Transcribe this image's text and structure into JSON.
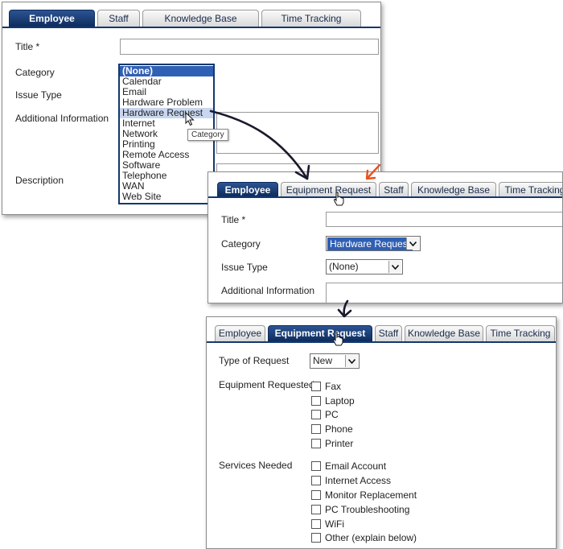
{
  "panel1": {
    "tabs": [
      "Employee",
      "Staff",
      "Knowledge Base",
      "Time Tracking"
    ],
    "labels": {
      "title": "Title *",
      "category": "Category",
      "issue_type": "Issue Type",
      "additional_info": "Additional Information",
      "description": "Description"
    },
    "dropdown": [
      "(None)",
      "Calendar",
      "Email",
      "Hardware Problem",
      "Hardware Request",
      "Internet",
      "Network",
      "Printing",
      "Remote Access",
      "Software",
      "Telephone",
      "WAN",
      "Web Site"
    ],
    "tooltip": "Category"
  },
  "panel2": {
    "tabs": [
      "Employee",
      "Equipment Request",
      "Staff",
      "Knowledge Base",
      "Time Tracking"
    ],
    "labels": {
      "title": "Title *",
      "category": "Category",
      "issue_type": "Issue Type",
      "additional_info": "Additional Information"
    },
    "category_value": "Hardware Request",
    "issue_type_value": "(None)"
  },
  "panel3": {
    "tabs": [
      "Employee",
      "Equipment Request",
      "Staff",
      "Knowledge Base",
      "Time Tracking"
    ],
    "labels": {
      "type_of_request": "Type of Request",
      "equipment_requested": "Equipment Requested",
      "services_needed": "Services Needed"
    },
    "type_of_request_value": "New",
    "equipment": [
      "Fax",
      "Laptop",
      "PC",
      "Phone",
      "Printer"
    ],
    "services": [
      "Email Account",
      "Internet Access",
      "Monitor Replacement",
      "PC Troubleshooting",
      "WiFi",
      "Other (explain below)"
    ]
  },
  "colors": {
    "tab_active": "#14386e",
    "highlight": "#3060b4",
    "annotation_arrow": "#1a1a2e",
    "accent_arrow": "#e8531c"
  }
}
